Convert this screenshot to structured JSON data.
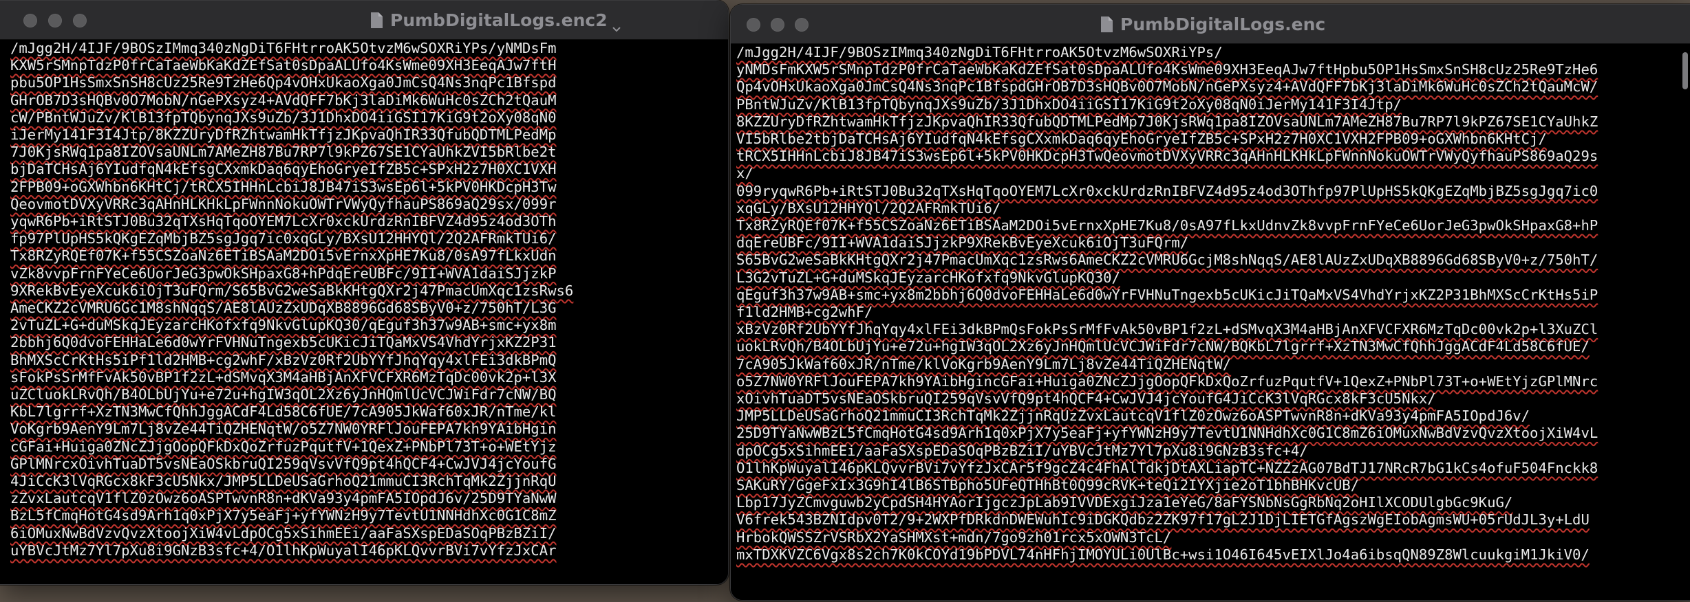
{
  "windows": {
    "left": {
      "title": "PumbDigitalLogs.enc2",
      "lines": [
        "/mJgg2H/4IJF/9BOSzIMmq340zNgDiT6FHtrroAK5OtvzM6wSOXRiYPs/yNMDsFm",
        "KXW5rSMnpTdzP0frCaTaeWbKaKdZEfSat0sDpaALUfo4KsWme09XH3EeqAJw7ftH",
        "pbu5OP1HsSmxSnSH8cUz25Re9TzHe6Qp4vOHxUkaoXga0JmCsQ4Ns3nqPc1Bfspd",
        "GHrOB7D3sHQBv0O7MobN/nGePXsyz4+AVdQFF7bKj3laDiMk6WuHc0sZCh2tQauM",
        "cW/PBntWJuZv/KlB13fpTQbynqJXs9uZb/3J1DhxDO4iiGSI17KiG9t2oXy08qN0",
        "iJerMy141F3I4Jtp/8KZZUryDfRZhtwamHkTfjzJKpvaQhIR33QfubQDTMLPedMp",
        "7J0KjsRWq1pa8IZOVsaUNLm7AMeZH87Bu7RP7l9kPZ67SE1CYaUhkZVI5bRlbe2t",
        "bjDaTCHsAj6YIudfqN4kEfsgCXxmkDaq6qyEhoGryeIfZB5c+SPxH2z7H0XC1VXH",
        "2FPB09+oGXWhbn6KHtCj/tRCX5IHHnLcbiJ8JB47iS3wsEp6l+5kPV0HKDcpH3Tw",
        "QeovmotDVXyVRRc3qAHnHLKHkLpFWnnNokuOWTrVWyQyfhauPS869aQ29sx/099r",
        "yqwR6Pb+iRtSTJ0Bu32qTXsHqTqoOYEM7LcXr0xckUrdzRnIBFVZ4d95z4od3OTh",
        "fp97PlUpHS5kQKgEZqMbjBZ5sgJgq7ic0xqGLy/BXsU12HHYQl/2Q2AFRmkTUi6/",
        "Tx8RZyRQEf07K+f55CSZoaNz6ETiBSAaM2DOi5vErnxXpHE7Ku8/0sA97fLkxUdn",
        "vZk8vvpFrnFYeCe6UorJeG3pwOkSHpaxG8+hPdqEreUBFc/9II+WVA1daiSJjzkP",
        "9XRekBvEyeXcuk6iOjT3uFQrm/S65BvG2weSaBkKHtgQXr2j47PmacUmXqc1zsRws6",
        "AmeCKZ2cVMRU6Gc1M8shNqqS/AE8lAUzZxUDqXB8896Gd68SByV0+z/750hT/L3G",
        "2vTuZL+G+duMSkqJEyzarcHKofxfq9NkvGlupKQ30/qEguf3h37w9AB+smc+yx8m",
        "2bbhj6Q0dvoFEHHaLe6d0wYrFVHNuTngexb5cUKicJiTQaMxVS4VhdYrjxKZ2P31",
        "BhMXScCrKtHs5iPf1ld2HMB+cg2whF/xBzVz0Rf2UbYYfJhqYqy4xlFEi3dkBPmQ",
        "sFokPsSrMfFvAk50vBP1f2zL+dSMvqX3M4aHBjAnXFVCFXR6MzTqDc00vk2p+l3X",
        "uZCluokLRvQh/B4OLbUjYu+e72u+hgIW3qOL2Xz6yJnHQmlUcVCJWiFdr7cNW/BQ",
        "KbL7lgrrf+XzTN3MwCfQhhJggACdF4Ld58C6fUE/7cA905JkWaf60xJR/nTme/kl",
        "VoKgrb9AenY9Lm7Lj8vZe44TiQZHENqtW/o5Z7NW0YRFlJouFEPA7kh9YAibHgin",
        "cGFai+Huiga0ZNcZJjgOopQFkDxQoZrfuzPqutfV+1QexZ+PNbPl73T+o+WEtYjz",
        "GPlMNrcxOivhTuaDT5vsNEaOSkbruQI259qVsvVfQ9pt4hQCF4+CwJVJ4jcYoufG",
        "4JiCcK3lVqRGcx8kF3cU5Nkx/JMP5LLDeUSaGrhoQ21mmuCI3RchTqMk2ZjjnRqU",
        "zZvxLautcqV1flZ0zOwz6oASPTwvnR8n+dKVa93y4pmFA5IOpdJ6v/25D9TYaNwW",
        "BzL5fCmqHotG4sd9Arh1q0xPjX7y5eaFj+yfYWNzH9y7TevtU1NNHdhXc0G1C8mZ",
        "6iOMuxNwBdVzvQvzXtoojXiW4vLdpOCg5xSihmEEi/aaFaSXspEDaSOqPBzBZiI/",
        "uYBVcJtMz7Yl7pXu8i9GNzB3sfc+4/O1lhKpWuyalI46pKLQvvrBVi7vYfzJxCAr"
      ]
    },
    "right": {
      "title": "PumbDigitalLogs.enc",
      "lines": [
        "/mJgg2H/4IJF/9BOSzIMmq340zNgDiT6FHtrroAK5OtvzM6wSOXRiYPs/",
        "yNMDsFmKXW5rSMnpTdzP0frCaTaeWbKaKdZEfSat0sDpaALUfo4KsWme09XH3EeqAJw7ftHpbu5OP1HsSmxSnSH8cUz25Re9TzHe6",
        "Qp4vOHxUkaoXga0JmCsQ4Ns3nqPc1BfspdGHrOB7D3sHQBv0O7MobN/nGePXsyz4+AVdQFF7bKj3laDiMk6WuHc0sZCh2tQauMcW/",
        "PBntWJuZv/KlB13fpTQbynqJXs9uZb/3J1DhxDO4iiGSI17KiG9t2oXy08qN0iJerMy141F3I4Jtp/",
        "8KZZUryDfRZhtwamHkTfjzJKpvaQhIR33QfubQDTMLPedMp7J0KjsRWq1pa8IZOVsaUNLm7AMeZH87Bu7RP7l9kPZ67SE1CYaUhkZ",
        "VI5bRlbe2tbjDaTCHsAj6YIudfqN4kEfsgCXxmkDaq6qyEhoGryeIfZB5c+SPxH2z7H0XC1VXH2FPB09+oGXWhbn6KHtCj/",
        "tRCX5IHHnLcbiJ8JB47iS3wsEp6l+5kPV0HKDcpH3TwQeovmotDVXyVRRc3qAHnHLKHkLpFWnnNokuOWTrVWyQyfhauPS869aQ29s",
        "x/",
        "099ryqwR6Pb+iRtSTJ0Bu32qTXsHqTqoOYEM7LcXr0xckUrdzRnIBFVZ4d95z4od3OThfp97PlUpHS5kQKgEZqMbjBZ5sgJgq7ic0",
        "xqGLy/BXsU12HHYQl/2Q2AFRmkTUi6/",
        "Tx8RZyRQEf07K+f55CSZoaNz6ETiBSAaM2DOi5vErnxXpHE7Ku8/0sA97fLkxUdnvZk8vvpFrnFYeCe6UorJeG3pwOkSHpaxG8+hP",
        "dqEreUBFc/9II+WVA1daiSJjzkP9XRekBvEyeXcuk6iOjT3uFQrm/",
        "S65BvG2weSaBkKHtgQXr2j47PmacUmXqc1zsRws6AmeCKZ2cVMRU6GcjM8shNqqS/AE8lAUzZxUDqXB8896Gd68SByV0+z/750hT/",
        "L3G2vTuZL+G+duMSkqJEyzarcHKofxfq9NkvGlupKQ30/",
        "qEguf3h37w9AB+smc+yx8m2bbhj6Q0dvoFEHHaLe6d0wYrFVHNuTngexb5cUKicJiTQaMxVS4VhdYrjxKZ2P31BhMXScCrKtHs5iP",
        "f1ld2HMB+cg2whF/",
        "xBzVz0Rf2UbYYfJhqYqy4xlFEi3dkBPmQsFokPsSrMfFvAk50vBP1f2zL+dSMvqX3M4aHBjAnXFVCFXR6MzTqDc00vk2p+l3XuZCl",
        "uokLRvQh/B4OLbUjYu+e72u+hgIW3qOL2Xz6yJnHQmlUcVCJWiFdr7cNW/BQKbL7lgrrf+XzTN3MwCfQhhJggACdF4Ld58C6fUE/",
        "7cA905JkWaf60xJR/nTme/klVoKgrb9AenY9Lm7Lj8vZe44TiQZHENqtW/",
        "o5Z7NW0YRFlJouFEPA7kh9YAibHgincGFai+Huiga0ZNcZJjgOopQFkDxQoZrfuzPqutfV+1QexZ+PNbPl73T+o+WEtYjzGPlMNrc",
        "xOivhTuaDT5vsNEaOSkbruQI259qVsvVfQ9pt4hQCF4+CwJVJ4jcYoufG4JiCcK3lVqRGcx8kF3cU5Nkx/",
        "JMP5LLDeUSaGrhoQ21mmuCI3RchTqMk2ZjjnRqUzZvxLautcqV1flZ0zOwz6oASPTwvnR8n+dKVa93y4pmFA5IOpdJ6v/",
        "25D9TYaNwWBzL5fCmqHotG4sd9Arh1q0xPjX7y5eaFj+yfYWNzH9y7TevtU1NNHdhXc0G1C8mZ6iOMuxNwBdVzvQvzXtoojXiW4vL",
        "dpOCg5xSihmEEi/aaFaSXspEDaSOqPBzBZiI/uYBVcJtMz7Yl7pXu8i9GNzB3sfc+4/",
        "O1lhKpWuyalI46pKLQvvrBVi7vYfzJxCAr5f9gcZ4c4FhAlTdkjDtAXLiapTC+NZZzAG07BdTJ17NRcR7bG1kCs4ofuF504Fnckk8",
        "SAKuRY/GgeFxIx3G9hI4lB6STBpho5UFeQTHhBt0Q99cRVK+teQi2IYXjie2oT1bhBHKvcUB/",
        "Lbp17JyZCmvguwb2yCpdSH4HYAorIjgczJpLab9IVVDExgiJza1eYeG/8aFYSNbNsGgRbNq2oHIlXCODUlgbGc9KuG/",
        "V6frek543BZNIdpv0T2/9+2WXPfDRkdnDWEWuhIc9iDGKQdbz2ZK97f17gL2J1DjLIETGfAgszWgEIobAgmsWU+05rUdJL3y+LdU",
        "HrbokQWSSZrVSRbX2YaSHMXst+mdn/7go9zh01rcx5xOWN3TcL/",
        "mxTDXKVZC6Vgx8s2ch7K0kCOYd19bPDVL74nHFhjIMOYULi0UlBc+wsi1O46I645vEIXlJo4a6ibsqQN89Z8WlcuukgiM1JkiV0/"
      ]
    }
  }
}
